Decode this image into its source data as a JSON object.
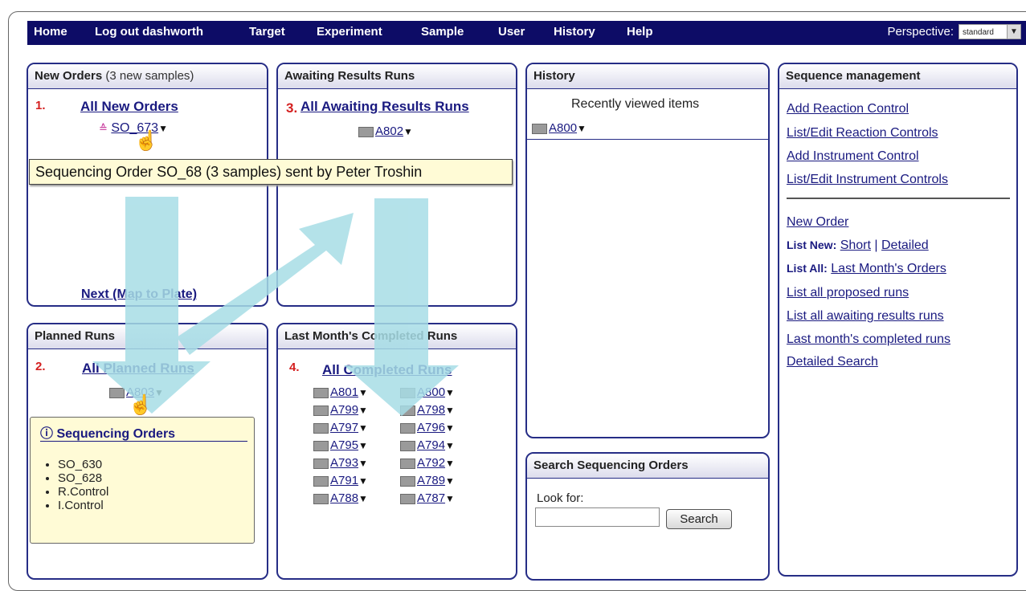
{
  "nav": {
    "items": [
      "Home",
      "Log out dashworth",
      "Target",
      "Experiment",
      "Sample",
      "User",
      "History",
      "Help"
    ],
    "perspective_label": "Perspective:",
    "perspective_value": "standard"
  },
  "new_orders": {
    "title": "New Orders",
    "count_text": "(3 new samples)",
    "number": "1.",
    "link": "All New Orders",
    "order": "SO_673",
    "next": "Next (Map to Plate)"
  },
  "tooltip": "Sequencing Order SO_68 (3 samples) sent by Peter Troshin",
  "awaiting": {
    "title": "Awaiting Results Runs",
    "number": "3.",
    "link": "All Awaiting Results Runs",
    "run": "A802"
  },
  "history": {
    "title": "History",
    "subtitle": "Recently viewed items",
    "item": "A800"
  },
  "seq_mgmt": {
    "title": "Sequence management",
    "links_top": [
      "Add Reaction Control",
      "List/Edit Reaction Controls",
      "Add Instrument Control",
      "List/Edit Instrument Controls"
    ],
    "new_order": "New Order",
    "list_new_label": "List New:",
    "list_new_short": "Short",
    "list_new_sep": "|",
    "list_new_detailed": "Detailed",
    "list_all_label": "List All:",
    "list_all_link": "Last Month's Orders",
    "links_bottom": [
      "List all proposed runs",
      "List all awaiting results runs",
      "Last month's completed runs",
      "Detailed Search"
    ]
  },
  "planned": {
    "title": "Planned Runs",
    "number": "2.",
    "link": "All Planned Runs",
    "run": "A803"
  },
  "infobox": {
    "title": "Sequencing Orders",
    "items": [
      "SO_630",
      "SO_628",
      "R.Control",
      "I.Control"
    ]
  },
  "completed": {
    "title": "Last Month's Completed Runs",
    "number": "4.",
    "link": "All Completed Runs",
    "runs": [
      "A801",
      "A800",
      "A799",
      "A798",
      "A797",
      "A796",
      "A795",
      "A794",
      "A793",
      "A792",
      "A791",
      "A789",
      "A788",
      "A787"
    ]
  },
  "search": {
    "title": "Search Sequencing Orders",
    "label": "Look for:",
    "value": "",
    "button": "Search"
  },
  "colors": {
    "nav_bg": "#0d0c66",
    "panel_border": "#262d86",
    "step_number": "#d42020",
    "arrow": "#a7dde6",
    "tooltip_bg": "#fffbd6"
  }
}
